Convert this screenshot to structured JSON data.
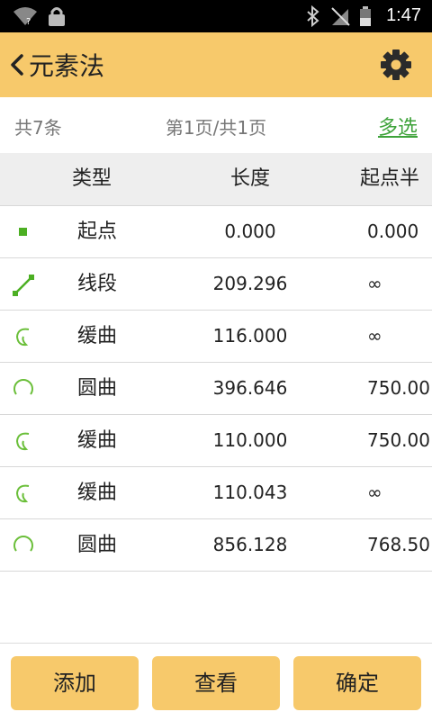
{
  "status_bar": {
    "time": "1:47"
  },
  "app_bar": {
    "title": "元素法"
  },
  "info": {
    "count": "共7条",
    "page": "第1页/共1页",
    "multi_select": "多选"
  },
  "table": {
    "headers": {
      "type": "类型",
      "length": "长度",
      "radius": "起点半"
    },
    "rows": [
      {
        "icon": "point-icon",
        "type": "起点",
        "length": "0.000",
        "radius": "0.000"
      },
      {
        "icon": "line-segment-icon",
        "type": "线段",
        "length": "209.296",
        "radius": "∞"
      },
      {
        "icon": "spiral-curve-icon",
        "type": "缓曲",
        "length": "116.000",
        "radius": "∞"
      },
      {
        "icon": "circular-curve-icon",
        "type": "圆曲",
        "length": "396.646",
        "radius": "750.00"
      },
      {
        "icon": "spiral-curve-icon",
        "type": "缓曲",
        "length": "110.000",
        "radius": "750.00"
      },
      {
        "icon": "spiral-curve-icon",
        "type": "缓曲",
        "length": "110.043",
        "radius": "∞"
      },
      {
        "icon": "circular-curve-icon",
        "type": "圆曲",
        "length": "856.128",
        "radius": "768.50"
      }
    ]
  },
  "buttons": {
    "add": "添加",
    "view": "查看",
    "confirm": "确定"
  },
  "colors": {
    "accent": "#f7c96b",
    "green": "#3fa33b",
    "icon_green": "#6bbf3a"
  }
}
